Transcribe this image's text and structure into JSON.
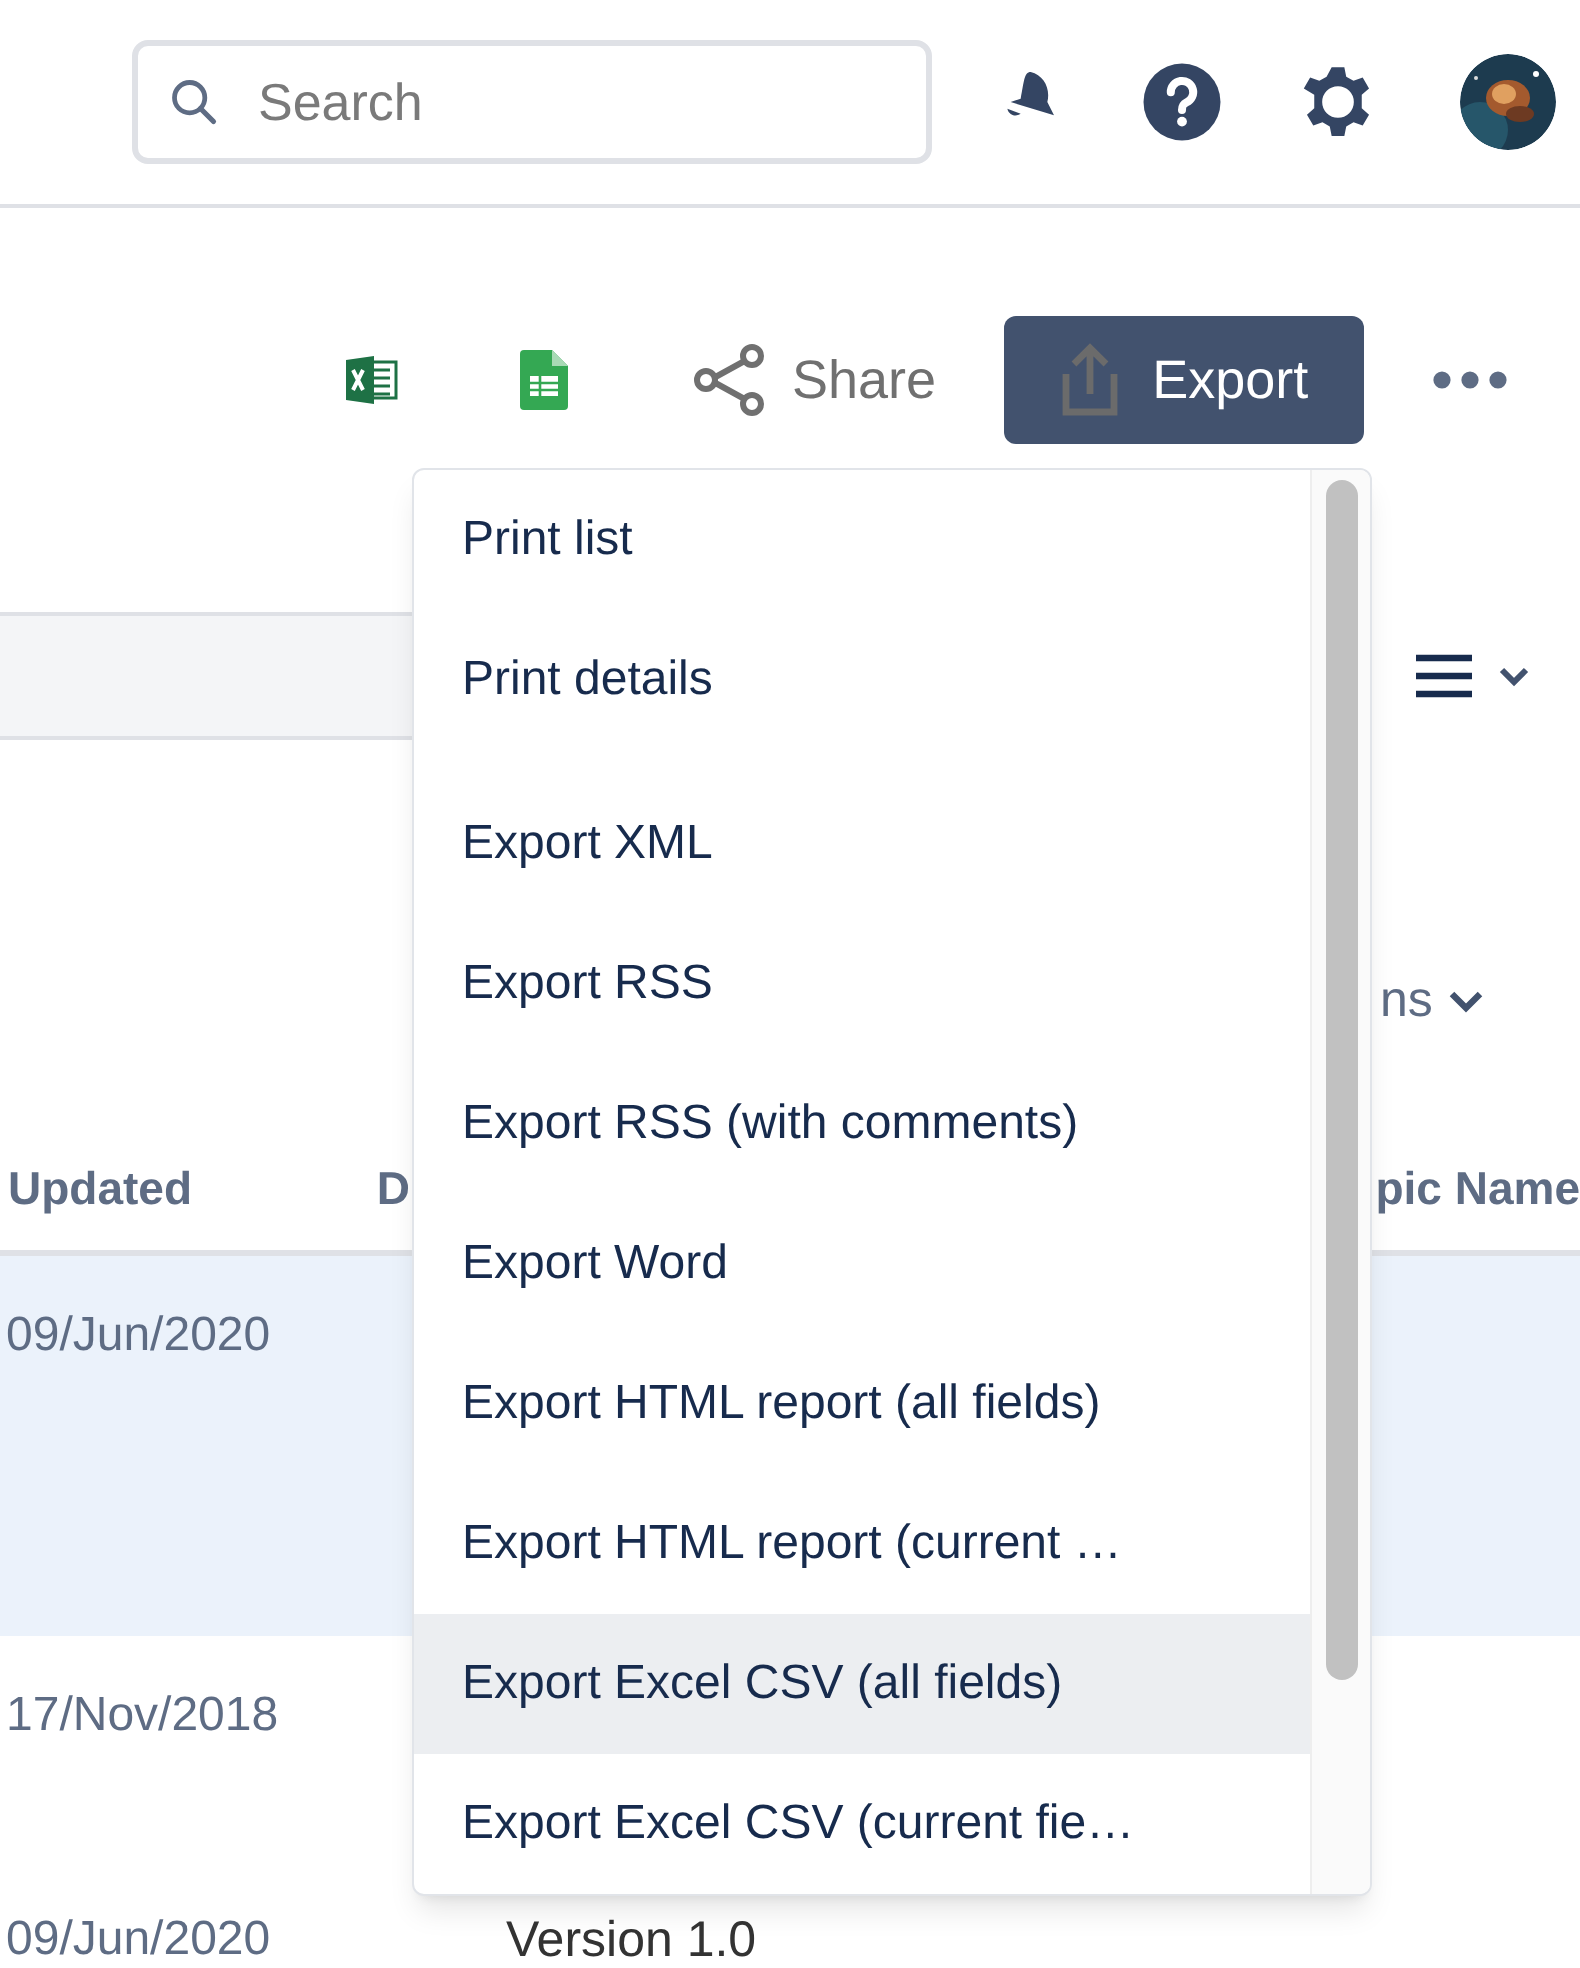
{
  "header": {
    "search": {
      "placeholder": "Search"
    }
  },
  "toolbar": {
    "share": "Share",
    "export": "Export"
  },
  "view_controls": {
    "columns_label": "ns"
  },
  "table": {
    "columns": [
      "Updated",
      "D",
      "pic Name"
    ],
    "rows": [
      {
        "updated": "09/Jun/2020",
        "selected": true
      },
      {
        "updated": "17/Nov/2018",
        "selected": false
      },
      {
        "updated": "09/Jun/2020",
        "column_2": "Version 1.0",
        "selected": false
      }
    ]
  },
  "export_menu": {
    "groups": [
      {
        "items": [
          {
            "label": "Print list",
            "selected": false
          },
          {
            "label": "Print details",
            "selected": false
          }
        ]
      },
      {
        "items": [
          {
            "label": "Export XML",
            "selected": false
          },
          {
            "label": "Export RSS",
            "selected": false
          },
          {
            "label": "Export RSS (with comments)",
            "selected": false
          },
          {
            "label": "Export Word",
            "selected": false
          },
          {
            "label": "Export HTML report (all fields)",
            "selected": false
          },
          {
            "label": "Export HTML report (current …",
            "selected": false
          },
          {
            "label": "Export Excel CSV (all fields)",
            "selected": true
          },
          {
            "label": "Export Excel CSV (current fie…",
            "selected": false
          }
        ]
      }
    ]
  }
}
